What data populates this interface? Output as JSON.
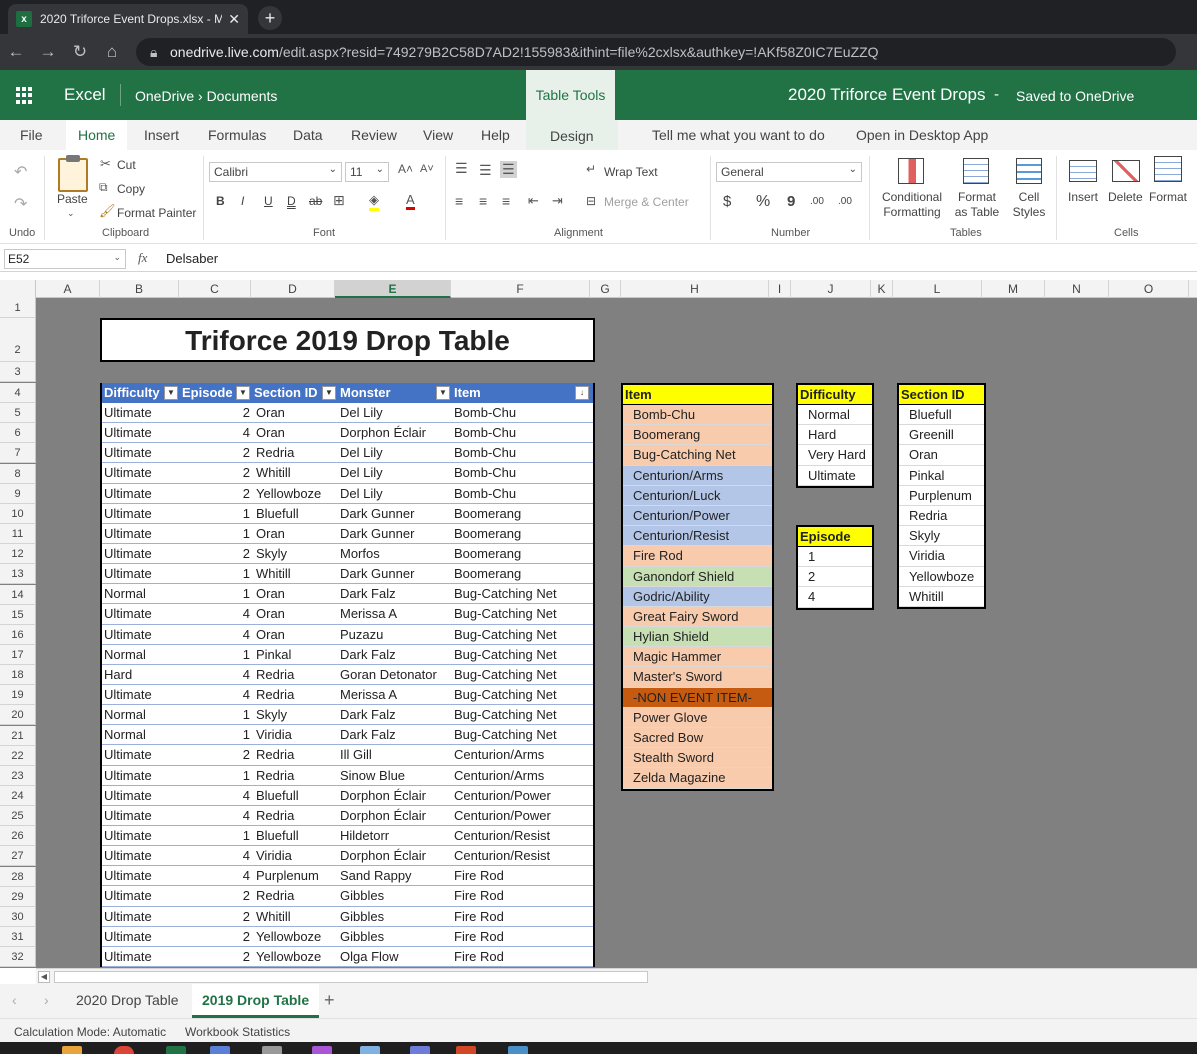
{
  "browser": {
    "tab_title": "2020 Triforce Event Drops.xlsx - M",
    "url_host": "onedrive.live.com",
    "url_path": "/edit.aspx?resid=749279B2C58D7AD2!155983&ithint=file%2cxlsx&authkey=!AKf58Z0IC7EuZZQ"
  },
  "appbar": {
    "app_name": "Excel",
    "breadcrumb": "OneDrive › Documents",
    "table_tools": "Table Tools",
    "doc_title": "2020 Triforce Event Drops",
    "dash": "-",
    "saved_status": "Saved to OneDrive"
  },
  "ribbon_tabs": {
    "file": "File",
    "home": "Home",
    "insert": "Insert",
    "formulas": "Formulas",
    "data": "Data",
    "review": "Review",
    "view": "View",
    "help": "Help",
    "design": "Design",
    "tell_me": "Tell me what you want to do",
    "open_desktop": "Open in Desktop App"
  },
  "ribbon": {
    "undo_label": "Undo",
    "paste": "Paste",
    "cut": "Cut",
    "copy": "Copy",
    "format_painter": "Format Painter",
    "clipboard_label": "Clipboard",
    "font_name": "Calibri",
    "font_size": "11",
    "font_label": "Font",
    "bold": "B",
    "italic": "I",
    "underline": "U",
    "double_underline": "D",
    "strike": "ab",
    "wrap_text": "Wrap Text",
    "merge_center": "Merge & Center",
    "alignment_label": "Alignment",
    "number_format": "General",
    "number_label": "Number",
    "currency": "$",
    "percent": "%",
    "comma": "9",
    "inc_decimal": ".00",
    "dec_decimal": ".00",
    "conditional_formatting": [
      "Conditional",
      "Formatting"
    ],
    "format_as_table": [
      "Format",
      "as Table"
    ],
    "cell_styles": [
      "Cell",
      "Styles"
    ],
    "tables_label": "Tables",
    "insert": "Insert",
    "delete": "Delete",
    "format": "Format",
    "cells_label": "Cells"
  },
  "formula_bar": {
    "name_box": "E52",
    "fx": "fx",
    "formula": "Delsaber"
  },
  "columns": [
    "A",
    "B",
    "C",
    "D",
    "E",
    "F",
    "G",
    "H",
    "I",
    "J",
    "K",
    "L",
    "M",
    "N",
    "O"
  ],
  "rows": [
    "1",
    "2",
    "3",
    "4",
    "5",
    "6",
    "7",
    "8",
    "9",
    "10",
    "11",
    "12",
    "13",
    "14",
    "15",
    "16",
    "17",
    "18",
    "19",
    "20",
    "21",
    "22",
    "23",
    "24",
    "25",
    "26",
    "27",
    "28",
    "29",
    "30",
    "31",
    "32"
  ],
  "sheet_title": "Triforce 2019 Drop Table",
  "drop_table": {
    "headers": [
      "Difficulty",
      "Episode",
      "Section ID",
      "Monster",
      "Item"
    ],
    "rows": [
      [
        "Ultimate",
        "2",
        "Oran",
        "Del Lily",
        "Bomb-Chu"
      ],
      [
        "Ultimate",
        "4",
        "Oran",
        "Dorphon Éclair",
        "Bomb-Chu"
      ],
      [
        "Ultimate",
        "2",
        "Redria",
        "Del Lily",
        "Bomb-Chu"
      ],
      [
        "Ultimate",
        "2",
        "Whitill",
        "Del Lily",
        "Bomb-Chu"
      ],
      [
        "Ultimate",
        "2",
        "Yellowboze",
        "Del Lily",
        "Bomb-Chu"
      ],
      [
        "Ultimate",
        "1",
        "Bluefull",
        "Dark Gunner",
        "Boomerang"
      ],
      [
        "Ultimate",
        "1",
        "Oran",
        "Dark Gunner",
        "Boomerang"
      ],
      [
        "Ultimate",
        "2",
        "Skyly",
        "Morfos",
        "Boomerang"
      ],
      [
        "Ultimate",
        "1",
        "Whitill",
        "Dark Gunner",
        "Boomerang"
      ],
      [
        "Normal",
        "1",
        "Oran",
        "Dark Falz",
        "Bug-Catching Net"
      ],
      [
        "Ultimate",
        "4",
        "Oran",
        "Merissa A",
        "Bug-Catching Net"
      ],
      [
        "Ultimate",
        "4",
        "Oran",
        "Puzazu",
        "Bug-Catching Net"
      ],
      [
        "Normal",
        "1",
        "Pinkal",
        "Dark Falz",
        "Bug-Catching Net"
      ],
      [
        "Hard",
        "4",
        "Redria",
        "Goran Detonator",
        "Bug-Catching Net"
      ],
      [
        "Ultimate",
        "4",
        "Redria",
        "Merissa A",
        "Bug-Catching Net"
      ],
      [
        "Normal",
        "1",
        "Skyly",
        "Dark Falz",
        "Bug-Catching Net"
      ],
      [
        "Normal",
        "1",
        "Viridia",
        "Dark Falz",
        "Bug-Catching Net"
      ],
      [
        "Ultimate",
        "2",
        "Redria",
        "Ill Gill",
        "Centurion/Arms"
      ],
      [
        "Ultimate",
        "1",
        "Redria",
        "Sinow Blue",
        "Centurion/Arms"
      ],
      [
        "Ultimate",
        "4",
        "Bluefull",
        "Dorphon Éclair",
        "Centurion/Power"
      ],
      [
        "Ultimate",
        "4",
        "Redria",
        "Dorphon Éclair",
        "Centurion/Power"
      ],
      [
        "Ultimate",
        "1",
        "Bluefull",
        "Hildetorr",
        "Centurion/Resist"
      ],
      [
        "Ultimate",
        "4",
        "Viridia",
        "Dorphon Éclair",
        "Centurion/Resist"
      ],
      [
        "Ultimate",
        "4",
        "Purplenum",
        "Sand Rappy",
        "Fire Rod"
      ],
      [
        "Ultimate",
        "2",
        "Redria",
        "Gibbles",
        "Fire Rod"
      ],
      [
        "Ultimate",
        "2",
        "Whitill",
        "Gibbles",
        "Fire Rod"
      ],
      [
        "Ultimate",
        "2",
        "Yellowboze",
        "Gibbles",
        "Fire Rod"
      ],
      [
        "Ultimate",
        "2",
        "Yellowboze",
        "Olga Flow",
        "Fire Rod"
      ]
    ]
  },
  "item_list": {
    "header": "Item",
    "items": [
      {
        "name": "Bomb-Chu",
        "color": "#f8cbad"
      },
      {
        "name": "Boomerang",
        "color": "#f8cbad"
      },
      {
        "name": "Bug-Catching Net",
        "color": "#f8cbad"
      },
      {
        "name": "Centurion/Arms",
        "color": "#b4c6e7"
      },
      {
        "name": "Centurion/Luck",
        "color": "#b4c6e7"
      },
      {
        "name": "Centurion/Power",
        "color": "#b4c6e7"
      },
      {
        "name": "Centurion/Resist",
        "color": "#b4c6e7"
      },
      {
        "name": "Fire Rod",
        "color": "#f8cbad"
      },
      {
        "name": "Ganondorf Shield",
        "color": "#c6e0b4"
      },
      {
        "name": "Godric/Ability",
        "color": "#b4c6e7"
      },
      {
        "name": "Great Fairy Sword",
        "color": "#f8cbad"
      },
      {
        "name": "Hylian Shield",
        "color": "#c6e0b4"
      },
      {
        "name": "Magic Hammer",
        "color": "#f8cbad"
      },
      {
        "name": "Master's Sword",
        "color": "#f8cbad"
      },
      {
        "name": "-NON EVENT ITEM-",
        "color": "#c55a11"
      },
      {
        "name": "Power Glove",
        "color": "#f8cbad"
      },
      {
        "name": "Sacred Bow",
        "color": "#f8cbad"
      },
      {
        "name": "Stealth Sword",
        "color": "#f8cbad"
      },
      {
        "name": "Zelda Magazine",
        "color": "#f8cbad"
      }
    ]
  },
  "difficulty_list": {
    "header": "Difficulty",
    "items": [
      "Normal",
      "Hard",
      "Very Hard",
      "Ultimate"
    ]
  },
  "episode_list": {
    "header": "Episode",
    "items": [
      "1",
      "2",
      "4"
    ]
  },
  "section_list": {
    "header": "Section ID",
    "items": [
      "Bluefull",
      "Greenill",
      "Oran",
      "Pinkal",
      "Purplenum",
      "Redria",
      "Skyly",
      "Viridia",
      "Yellowboze",
      "Whitill"
    ]
  },
  "sheets": {
    "tab1": "2020 Drop Table",
    "tab2": "2019 Drop Table",
    "add": "+"
  },
  "status": {
    "calc_mode": "Calculation Mode: Automatic",
    "workbook_stats": "Workbook Statistics"
  },
  "colors": {
    "excel_green": "#217346",
    "table_header_blue": "#4472c4",
    "list_header_yellow": "#ffff00"
  }
}
